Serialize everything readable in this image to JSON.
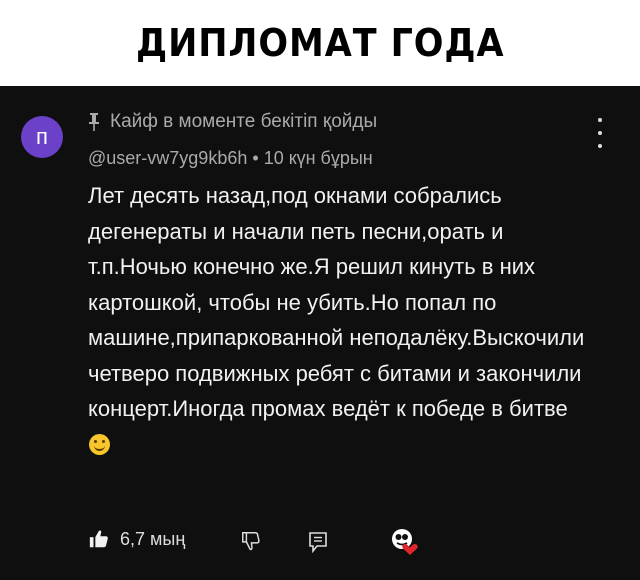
{
  "header": {
    "title": "ДИПЛОМАТ ГОДА"
  },
  "comment": {
    "avatar_letter": "п",
    "pinned_label": "Кайф в моменте бекітіп қойды",
    "author": "@user-vw7yg9kb6h",
    "separator": "•",
    "time_ago": "10 күн бұрын",
    "text": "Лет десять назад,под окнами собрались дегенераты и начали петь песни,орать и т.п.Ночью конечно же.Я решил кинуть в них картошкой, чтобы не убить.Но попал по машине,припаркованной неподалёку.Выскочили четверо подвижных ребят с битами и закончили концерт.Иногда промах ведёт к победе в битве",
    "emoji": "smiling-face-emoji",
    "likes": "6,7 мың"
  },
  "icons": {
    "pin": "pin-icon",
    "like": "thumbs-up-icon",
    "dislike": "thumbs-down-icon",
    "reply": "reply-icon",
    "heart": "creator-heart-icon",
    "menu": "more-vert-icon"
  },
  "colors": {
    "background": "#0f0f0f",
    "avatar": "#6b41c9",
    "heart": "#e1252c"
  }
}
